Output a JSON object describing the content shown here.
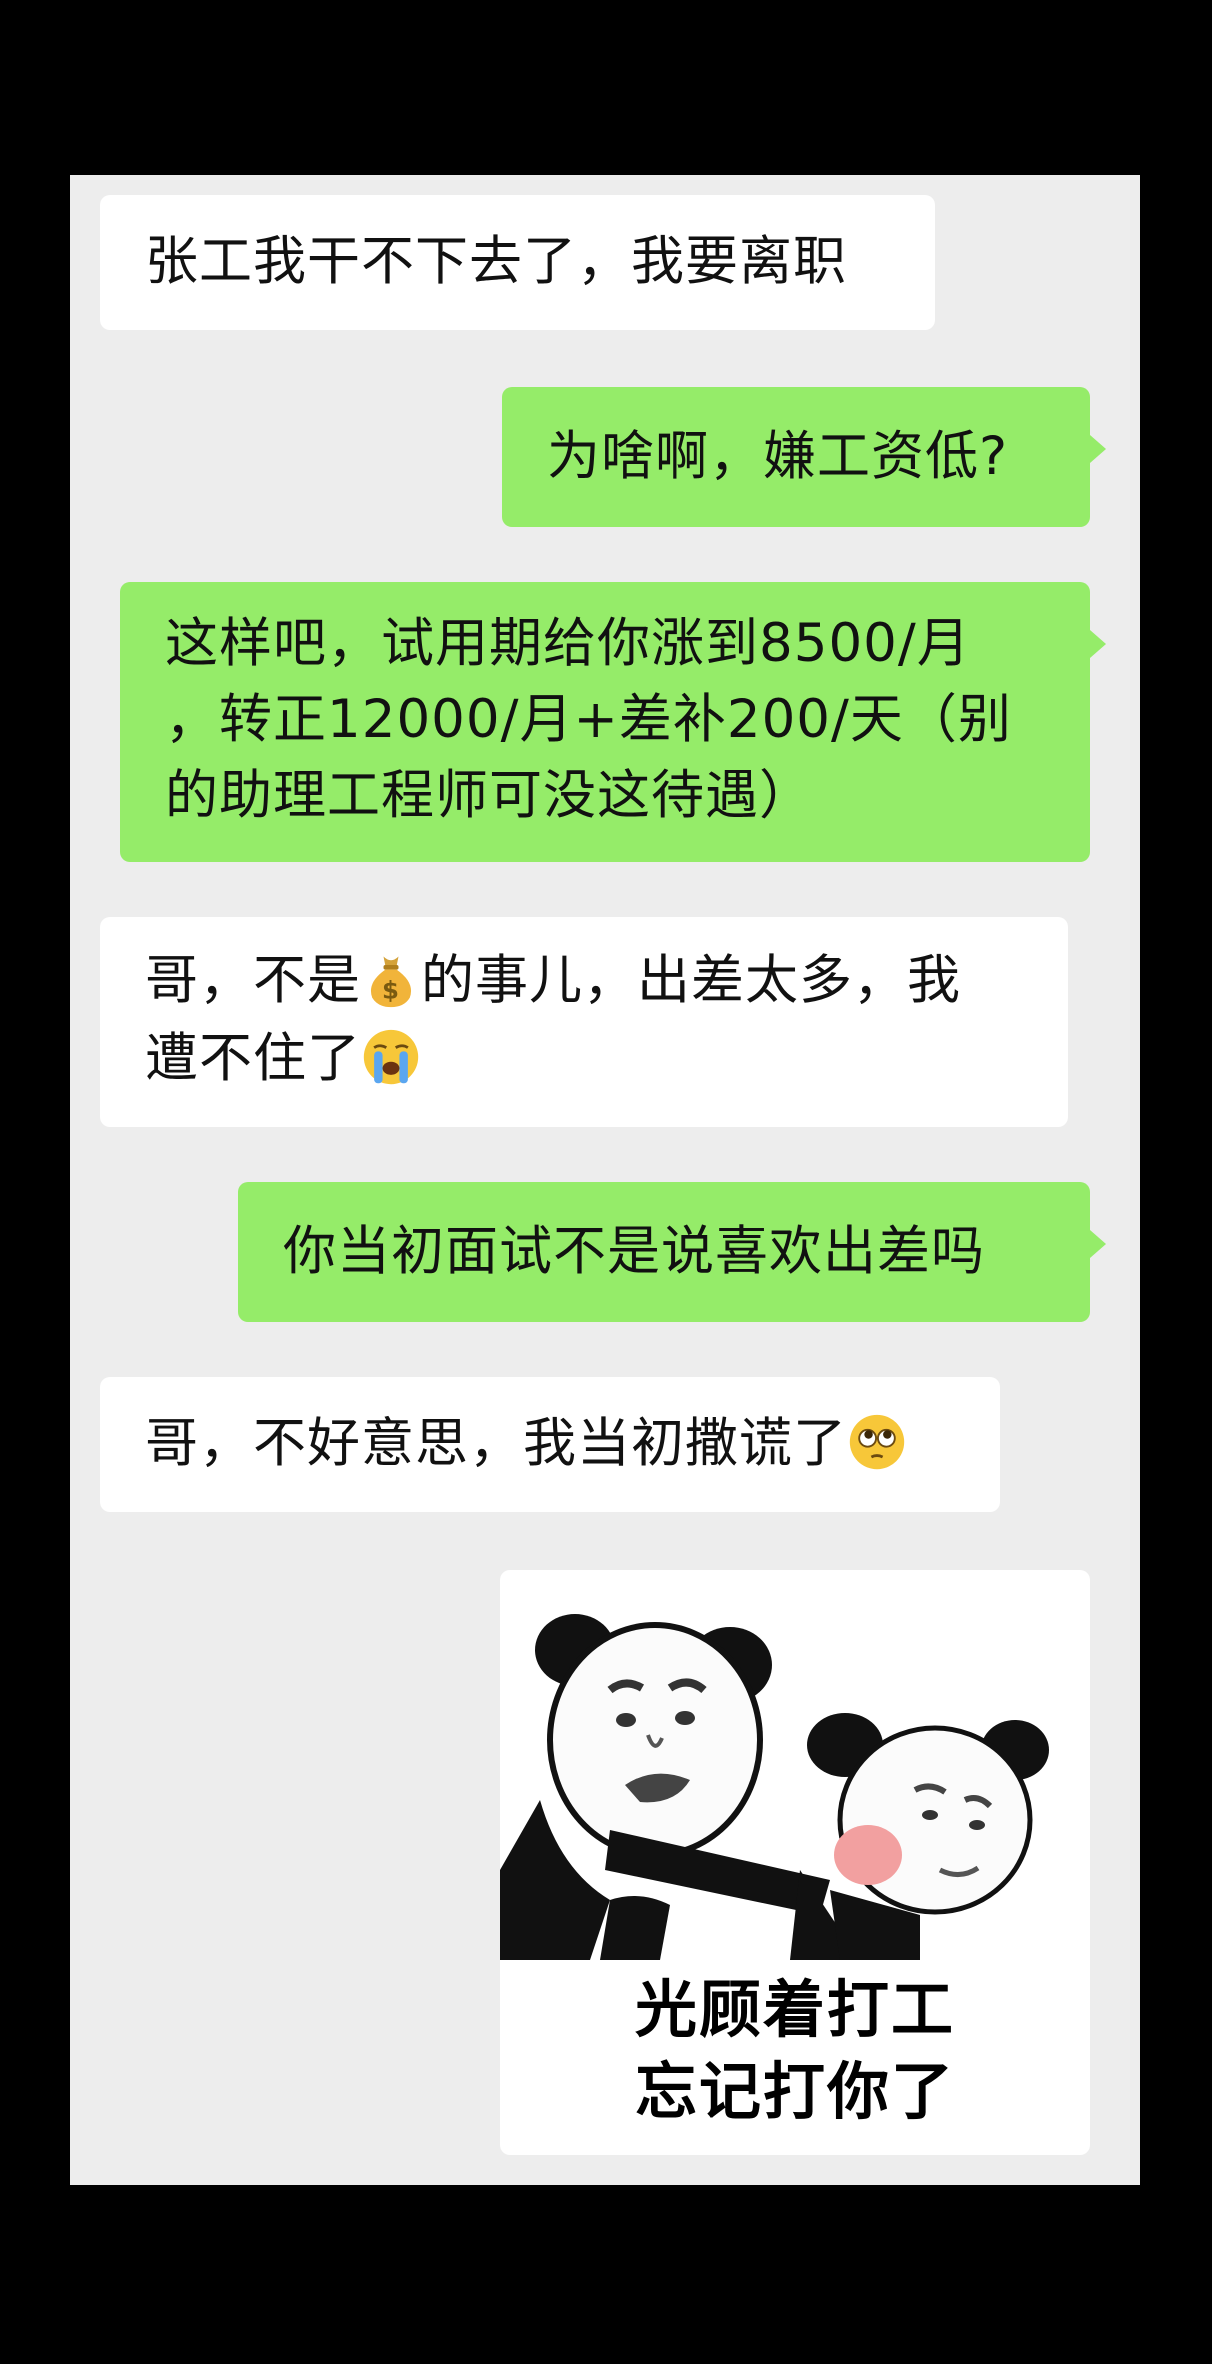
{
  "messages": [
    {
      "side": "left",
      "lines": [
        "张工我干不下去了，我要离职"
      ]
    },
    {
      "side": "right",
      "lines": [
        "为啥啊，嫌工资低?"
      ]
    },
    {
      "side": "right",
      "lines": [
        "这样吧，试用期给你涨到8500/月",
        "，转正12000/月+差补200/天（别",
        "的助理工程师可没这待遇）"
      ]
    },
    {
      "side": "left",
      "line1_a": "哥，不是",
      "line1_b": "的事儿，出差太多，我",
      "line2": "遭不住了",
      "emoji1": "money-bag-icon",
      "emoji2": "crying-face-icon"
    },
    {
      "side": "right",
      "lines": [
        "你当初面试不是说喜欢出差吗"
      ]
    },
    {
      "side": "left",
      "text": "哥，不好意思，我当初撒谎了",
      "emoji": "pleading-face-icon"
    }
  ],
  "sticker": {
    "caption_line1": "光顾着打工",
    "caption_line2": "忘记打你了"
  },
  "colors": {
    "background": "#000000",
    "chat_panel": "#ededed",
    "left_bubble": "#ffffff",
    "right_bubble": "#95ec69"
  }
}
